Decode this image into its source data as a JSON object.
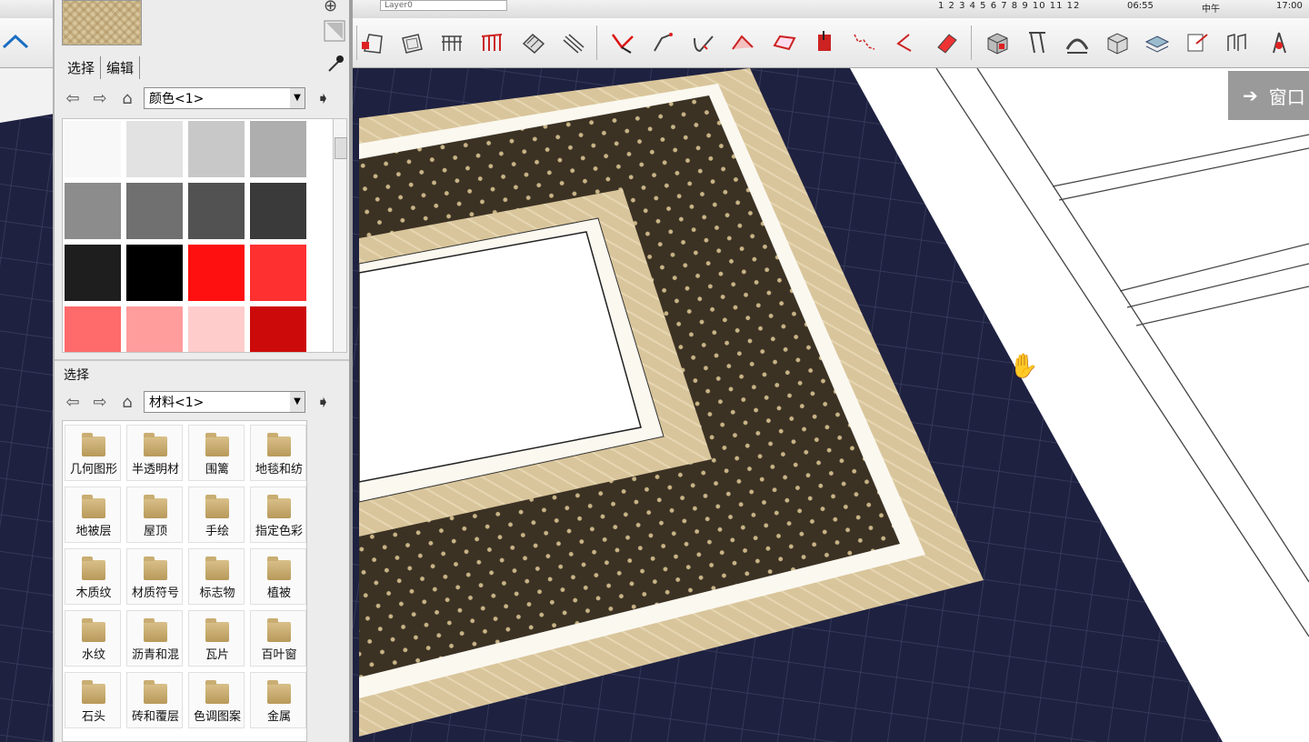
{
  "top_strip": {
    "layer_name": "Layer0",
    "shadow_months": "1 2 3 4 5 6 7 8 9 10 11 12",
    "time_start": "06:55",
    "time_noon": "中午",
    "time_end": "17:00"
  },
  "window_button": {
    "label": "窗口"
  },
  "materials_panel": {
    "tabs": [
      "选择",
      "编辑"
    ],
    "colors_combo": "颜色<1>",
    "colors": [
      "#f8f8f8",
      "#e2e2e2",
      "#c8c8c8",
      "#aeaeae",
      "#8c8c8c",
      "#707070",
      "#525252",
      "#3a3a3a",
      "#1e1e1e",
      "#000000",
      "#ff1010",
      "#ff3030",
      "#ff6a6a",
      "#ff9c9c",
      "#ffcccc",
      "#cc0a0a"
    ],
    "section2_label": "选择",
    "library_combo": "材料<1>",
    "library_items": [
      "几何图形",
      "半透明材",
      "围篱",
      "地毯和纺",
      "地被层",
      "屋顶",
      "手绘",
      "指定色彩",
      "木质纹",
      "材质符号",
      "标志物",
      "植被",
      "水纹",
      "沥青和混",
      "瓦片",
      "百叶窗",
      "石头",
      "砖和覆层",
      "色调图案",
      "金属"
    ]
  },
  "icons": {
    "toolbar": [
      "wall-icon",
      "frame-icon",
      "grid-icon",
      "railing-icon",
      "stairs-icon",
      "slope-icon",
      "axes-red-icon",
      "arc-tool-icon",
      "check-tool-icon",
      "roof-icon",
      "plane-icon",
      "push-icon",
      "curve-icon",
      "angle-icon",
      "eraser-icon",
      "box-icon",
      "pillar-icon",
      "arch-icon",
      "cube-icon",
      "layer-stack-icon",
      "export-icon",
      "scale-icon",
      "compass-icon"
    ]
  }
}
